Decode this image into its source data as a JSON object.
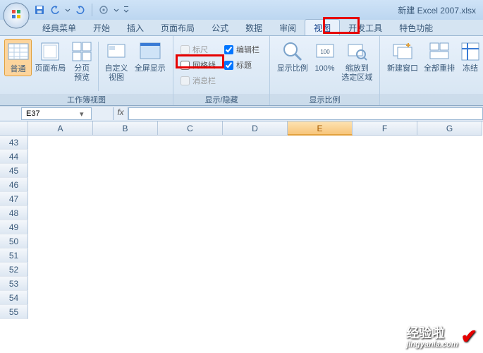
{
  "title": "新建 Excel 2007.xlsx",
  "tabs": {
    "classic": "经典菜单",
    "home": "开始",
    "insert": "插入",
    "pagelayout": "页面布局",
    "formulas": "公式",
    "data": "数据",
    "review": "审阅",
    "view": "视图",
    "developer": "开发工具",
    "special": "特色功能"
  },
  "ribbon": {
    "workbook_views": {
      "label": "工作簿视图",
      "normal": "普通",
      "page_layout": "页面布局",
      "page_break": "分页\n预览",
      "custom": "自定义\n视图",
      "fullscreen": "全屏显示"
    },
    "show_hide": {
      "label": "显示/隐藏",
      "ruler": "标尺",
      "formula_bar": "编辑栏",
      "gridlines": "网格线",
      "headings": "标题",
      "message_bar": "消息栏"
    },
    "zoom": {
      "label": "显示比例",
      "zoom": "显示比例",
      "hundred": "100%",
      "to_selection": "缩放到\n选定区域"
    },
    "window": {
      "new_window": "新建窗口",
      "arrange_all": "全部重排",
      "freeze": "冻结"
    }
  },
  "namebox": "E37",
  "columns": [
    "A",
    "B",
    "C",
    "D",
    "E",
    "F",
    "G"
  ],
  "row_start": 43,
  "row_count": 13,
  "active_col": "E",
  "watermark": {
    "main": "经验啦",
    "sub": "jingyanla.com"
  }
}
